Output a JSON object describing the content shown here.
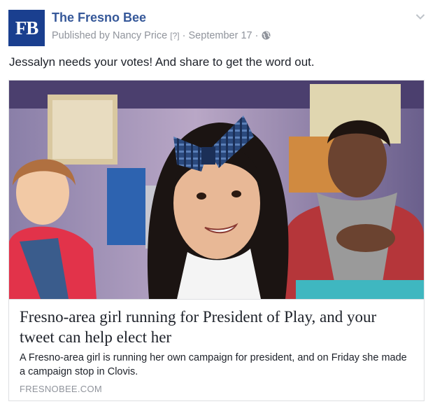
{
  "header": {
    "avatar_text": "FB",
    "page_name": "The Fresno Bee",
    "published_by": "Published by Nancy Price",
    "help_marker": "[?]",
    "separator": "·",
    "date": "September 17",
    "separator2": "·"
  },
  "post": {
    "text": "Jessalyn needs your votes! And share to get the word out."
  },
  "link_card": {
    "title": "Fresno-area girl running for President of Play, and your tweet can help elect her",
    "description": "A Fresno-area girl is running her own campaign for president, and on Friday she made a campaign stop in Clovis.",
    "domain": "FRESNOBEE.COM"
  },
  "colors": {
    "brand_blue": "#1a3f8f",
    "link_blue": "#365899",
    "meta_gray": "#90949c"
  },
  "icons": {
    "privacy": "globe-icon",
    "options": "chevron-down-icon"
  }
}
